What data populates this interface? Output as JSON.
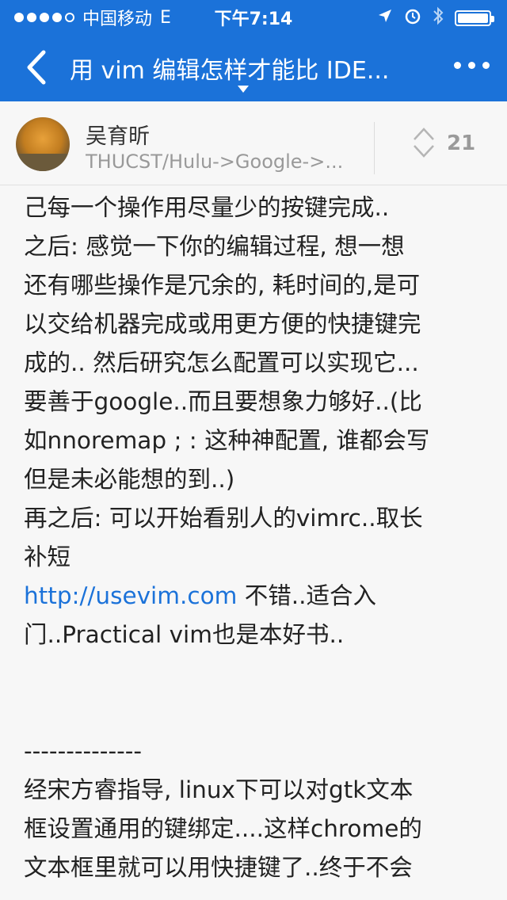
{
  "status": {
    "carrier": "中国移动",
    "network": "E",
    "time": "下午7:14"
  },
  "nav": {
    "title": "用 vim 编辑怎样才能比 IDE..."
  },
  "author": {
    "name": "吴育昕",
    "bio": "THUCST/Hulu->Google->...",
    "votes": "21"
  },
  "content": {
    "lines": [
      "己每一个操作用尽量少的按键完成..",
      "之后: 感觉一下你的编辑过程, 想一想",
      "还有哪些操作是冗余的, 耗时间的,是可",
      "以交给机器完成或用更方便的快捷键完",
      "成的.. 然后研究怎么配置可以实现它...",
      "要善于google..而且要想象力够好..(比",
      "如nnoremap ; : 这种神配置, 谁都会写",
      "但是未必能想的到..)",
      "再之后: 可以开始看别人的vimrc..取长",
      "补短"
    ],
    "link_text": "http://usevim.com",
    "after_link": " 不错..适合入",
    "line_after_link": "门..Practical vim也是本好书..",
    "separator": "--------------",
    "lines2": [
      "经宋方睿指导, linux下可以对gtk文本",
      "框设置通用的键绑定....这样chrome的",
      "文本框里就可以用快捷键了..终于不会"
    ]
  }
}
